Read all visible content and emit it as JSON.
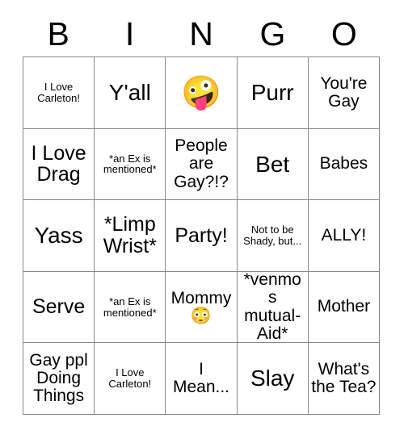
{
  "card": {
    "title_letters": [
      "B",
      "I",
      "N",
      "G",
      "O"
    ],
    "columns": 5,
    "rows": 5,
    "border_color": "#888888",
    "text_color": "#000000",
    "background_color": "#ffffff"
  },
  "cells": [
    {
      "text": "I Love Carleton!",
      "size": "sm",
      "emoji": ""
    },
    {
      "text": "Y'all",
      "size": "xl",
      "emoji": ""
    },
    {
      "text": "",
      "size": "md",
      "emoji": "🤪"
    },
    {
      "text": "Purr",
      "size": "xl",
      "emoji": ""
    },
    {
      "text": "You're Gay",
      "size": "md",
      "emoji": ""
    },
    {
      "text": "I Love Drag",
      "size": "lg",
      "emoji": ""
    },
    {
      "text": "*an Ex is mentioned*",
      "size": "sm",
      "emoji": ""
    },
    {
      "text": "People are Gay?!?",
      "size": "md",
      "emoji": ""
    },
    {
      "text": "Bet",
      "size": "xl",
      "emoji": ""
    },
    {
      "text": "Babes",
      "size": "md",
      "emoji": ""
    },
    {
      "text": "Yass",
      "size": "xl",
      "emoji": ""
    },
    {
      "text": "*Limp Wrist*",
      "size": "lg",
      "emoji": ""
    },
    {
      "text": "Party!",
      "size": "lg",
      "emoji": ""
    },
    {
      "text": "Not to be Shady, but...",
      "size": "sm",
      "emoji": ""
    },
    {
      "text": "ALLY!",
      "size": "md",
      "emoji": ""
    },
    {
      "text": "Serve",
      "size": "lg",
      "emoji": ""
    },
    {
      "text": "*an Ex is mentioned*",
      "size": "sm",
      "emoji": ""
    },
    {
      "text": "Mommy",
      "size": "md",
      "emoji": "😳"
    },
    {
      "text": "*venmos mutual-Aid*",
      "size": "md",
      "emoji": ""
    },
    {
      "text": "Mother",
      "size": "md",
      "emoji": ""
    },
    {
      "text": "Gay ppl Doing Things",
      "size": "md",
      "emoji": ""
    },
    {
      "text": "I Love Carleton!",
      "size": "sm",
      "emoji": ""
    },
    {
      "text": "I Mean...",
      "size": "md",
      "emoji": ""
    },
    {
      "text": "Slay",
      "size": "xl",
      "emoji": ""
    },
    {
      "text": "What's the Tea?",
      "size": "md",
      "emoji": ""
    }
  ],
  "icons": {
    "zany_face": "zany-face-emoji",
    "flushed_face": "flushed-face-emoji"
  }
}
